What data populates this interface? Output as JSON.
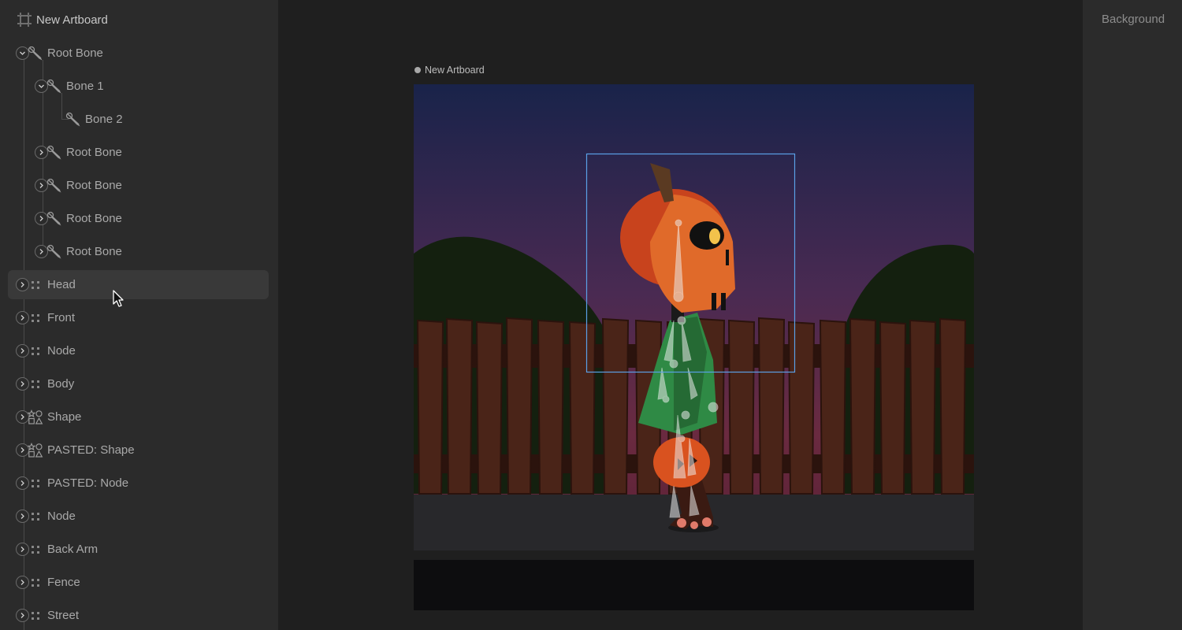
{
  "artboard_header": {
    "title": "New Artboard",
    "icon": "artboard-icon"
  },
  "hierarchy": [
    {
      "label": "Root Bone",
      "icon": "bone-icon",
      "expanded": true,
      "depth": 0
    },
    {
      "label": "Bone 1",
      "icon": "bone-icon",
      "expanded": true,
      "depth": 1
    },
    {
      "label": "Bone 2",
      "icon": "bone-icon",
      "expanded": null,
      "depth": 2
    },
    {
      "label": "Root Bone",
      "icon": "bone-icon",
      "expanded": false,
      "depth": 1
    },
    {
      "label": "Root Bone",
      "icon": "bone-icon",
      "expanded": false,
      "depth": 1
    },
    {
      "label": "Root Bone",
      "icon": "bone-icon",
      "expanded": false,
      "depth": 1
    },
    {
      "label": "Root Bone",
      "icon": "bone-icon",
      "expanded": false,
      "depth": 1
    },
    {
      "label": "Head",
      "icon": "node-icon",
      "expanded": false,
      "depth": 0,
      "selected": true
    },
    {
      "label": "Front",
      "icon": "node-icon",
      "expanded": false,
      "depth": 0
    },
    {
      "label": "Node",
      "icon": "node-icon",
      "expanded": false,
      "depth": 0
    },
    {
      "label": "Body",
      "icon": "node-icon",
      "expanded": false,
      "depth": 0
    },
    {
      "label": "Shape",
      "icon": "shape-icon",
      "expanded": false,
      "depth": 0
    },
    {
      "label": "PASTED: Shape",
      "icon": "shape-icon",
      "expanded": false,
      "depth": 0
    },
    {
      "label": "PASTED: Node",
      "icon": "node-icon",
      "expanded": false,
      "depth": 0
    },
    {
      "label": "Node",
      "icon": "node-icon",
      "expanded": false,
      "depth": 0
    },
    {
      "label": "Back Arm",
      "icon": "node-icon",
      "expanded": false,
      "depth": 0
    },
    {
      "label": "Fence",
      "icon": "node-icon",
      "expanded": false,
      "depth": 0
    },
    {
      "label": "Street",
      "icon": "node-icon",
      "expanded": false,
      "depth": 0
    }
  ],
  "stage": {
    "artboard_label": "New Artboard"
  },
  "right_panel": {
    "background_label": "Background"
  },
  "colors": {
    "panel": "#2b2b2b",
    "stage": "#1f1f1f",
    "selection_box": "#5aa0e6",
    "pumpkin": "#d9521f",
    "jacket": "#2f8a45"
  }
}
